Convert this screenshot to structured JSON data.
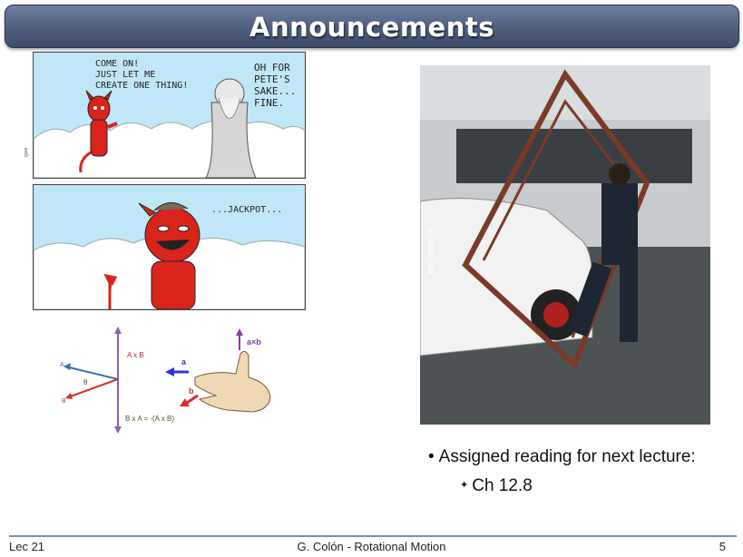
{
  "slide": {
    "title": "Announcements",
    "comic": {
      "panel1_devil_text": "COME ON!\nJUST LET ME\nCREATE ONE THING!",
      "panel1_god_text": "OH FOR\nPETE'S\nSAKE...\nFINE.",
      "panel2_text": "...JACKPOT...",
      "watermark": "qwe"
    },
    "diagram": {
      "label_axb": "A x B",
      "label_bxa": "B x A = -(A x B)",
      "label_a": "A",
      "label_b": "B",
      "label_theta": "θ",
      "hand_a": "a",
      "hand_b": "b",
      "hand_axb": "a×b"
    },
    "photo": {
      "watermark": "VIA 9GAG.COM"
    },
    "bullets": {
      "main": "Assigned reading for next lecture:",
      "sub": "Ch 12.8"
    },
    "footer": {
      "left": "Lec 21",
      "center": "G. Colón  -  Rotational Motion",
      "page_number": "5"
    },
    "colors": {
      "title_bar": "#4f5f80",
      "footer_rule": "#7d8fae",
      "devil_red": "#d9241c"
    }
  }
}
